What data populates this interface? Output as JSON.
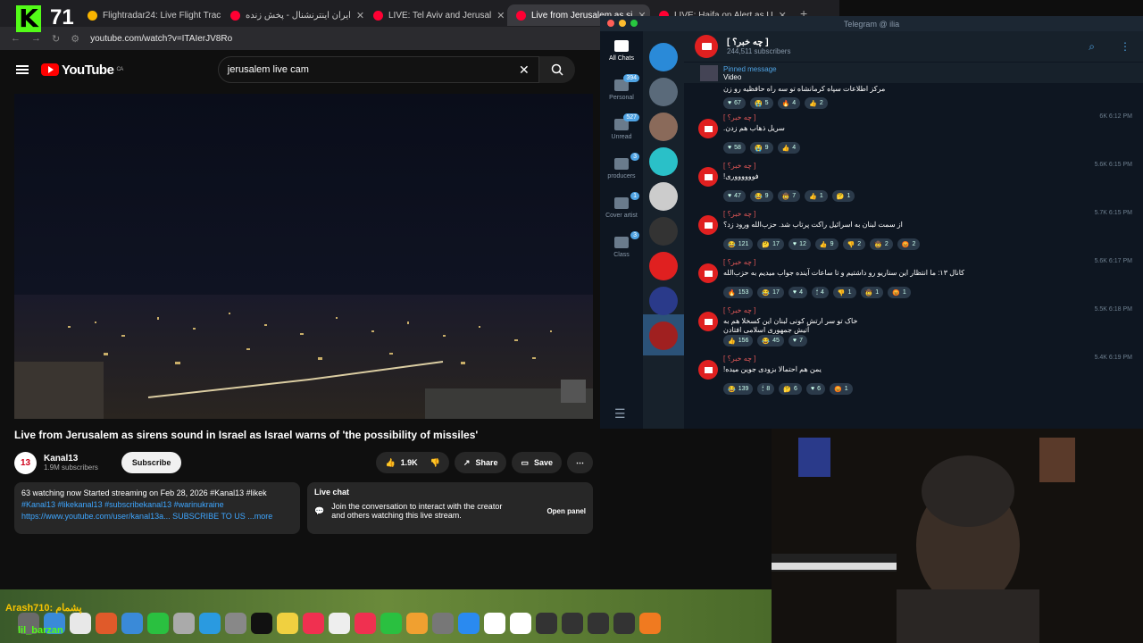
{
  "stream": {
    "viewers": "71",
    "chat1": "Arash710: پشمام",
    "chat2": "lil_barzan"
  },
  "browser": {
    "tabs": [
      {
        "label": "Flightradar24: Live Flight Trac",
        "active": false
      },
      {
        "label": "ایران اینترنشنال - پخش زنده",
        "active": false
      },
      {
        "label": "LIVE: Tel Aviv and Jerusal",
        "active": false
      },
      {
        "label": "Live from Jerusalem as si",
        "active": true
      },
      {
        "label": "LIVE: Haifa on Alert as U",
        "active": false
      }
    ],
    "url": "youtube.com/watch?v=ITAIerJV8Ro"
  },
  "youtube": {
    "logo": "YouTube",
    "country": "CA",
    "search_value": "jerusalem live cam",
    "video_title": "Live from Jerusalem as sirens sound in Israel as Israel warns of 'the possibility of missiles'",
    "channel": {
      "logo_text": "13",
      "name": "Kanal13",
      "subs": "1.9M subscribers"
    },
    "subscribe": "Subscribe",
    "likes": "1.9K",
    "share": "Share",
    "save": "Save",
    "desc_line1": "63 watching now  Started streaming on Feb 28, 2026  #Kanal13 #likek",
    "desc_tags": "#Kanal13 #likekanal13 #subscribekanal13 #warinukraine",
    "desc_link": "https://www.youtube.com/user/kanal13a... SUBSCRIBE TO US ...more",
    "livechat_title": "Live chat",
    "livechat_text": "Join the conversation to interact with the creator and others watching this live stream.",
    "open_panel": "Open panel"
  },
  "telegram": {
    "window_title": "Telegram @ ilia",
    "folders": [
      {
        "label": "All Chats",
        "badge": ""
      },
      {
        "label": "Personal",
        "badge": "394"
      },
      {
        "label": "Unread",
        "badge": "527"
      },
      {
        "label": "producers",
        "badge": "3"
      },
      {
        "label": "Cover artist",
        "badge": "1"
      },
      {
        "label": "Class",
        "badge": "3"
      }
    ],
    "channel_name": "[ چه خبر؟ ]",
    "channel_subs": "244,511 subscribers",
    "pinned_label": "Pinned message",
    "pinned_text": "Video",
    "messages": [
      {
        "text": "مرکز اطلاعات سپاه کرمانشاه تو سه راه حافظیه رو زن",
        "meta": "",
        "reacts": [
          "67",
          "5",
          "4",
          "2"
        ]
      },
      {
        "text": "سریل ذهاب هم زدن.",
        "meta": "6K 6:12 PM",
        "reacts": [
          "58",
          "9",
          "4"
        ]
      },
      {
        "text": "فووووووری!",
        "meta": "5.6K 6:15 PM",
        "reacts": [
          "47",
          "9",
          "7",
          "1",
          "1"
        ]
      },
      {
        "text": "از سمت لبنان به اسرائیل راکت پرتاب شد. حزب‌الله ورود زد؟",
        "meta": "5.7K 6:15 PM",
        "reacts": [
          "121",
          "17",
          "12",
          "9",
          "2",
          "2",
          "2"
        ]
      },
      {
        "text": "کانال ۱۳: ما انتظار این سناریو رو داشتیم و تا ساعات آینده جواب میدیم به حزب‌الله",
        "meta": "5.6K 6:17 PM",
        "reacts": [
          "153",
          "17",
          "4",
          "4",
          "1",
          "1",
          "1"
        ]
      },
      {
        "text": "خاک تو سر ارتش کونی لبنان این کسخلا هم به آتیش جمهوری اسلامی افتادن",
        "meta": "5.5K 6:18 PM",
        "reacts": [
          "156",
          "45",
          "7"
        ]
      },
      {
        "text": "یمن هم احتمالا بزودی جوین میده!",
        "meta": "5.4K 6:19 PM",
        "reacts": [
          "139",
          "8",
          "6",
          "6",
          "1"
        ]
      }
    ],
    "sender": "[ چه خبر؟ ]"
  }
}
